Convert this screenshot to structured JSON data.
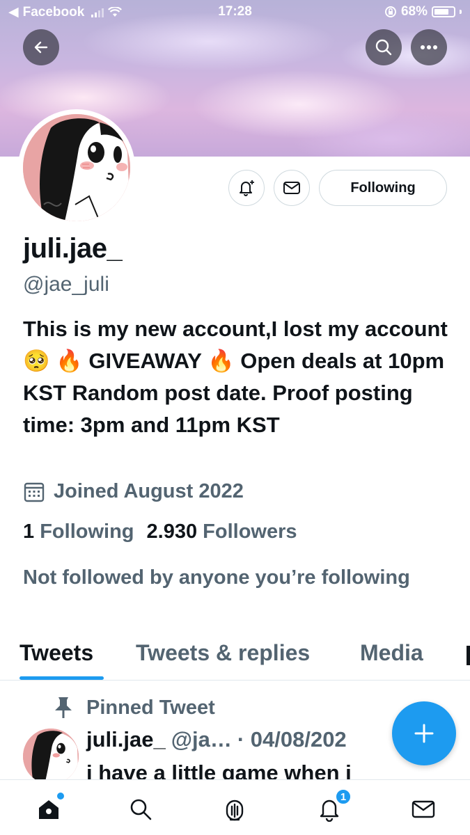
{
  "status_bar": {
    "back_app": "Facebook",
    "time": "17:28",
    "battery": "68%"
  },
  "profile": {
    "display_name": "juli.jae_",
    "handle": "@jae_juli",
    "bio": "This is my new account,I lost my account🥺 🔥 GIVEAWAY 🔥 Open deals at 10pm KST Random post date. Proof posting time: 3pm and 11pm KST",
    "joined": "Joined August 2022",
    "following_count": "1",
    "following_label": "Following",
    "followers_count": "2.930",
    "followers_label": "Followers",
    "not_followed": "Not followed by anyone you’re following",
    "follow_button_label": "Following"
  },
  "tabs": [
    {
      "label": "Tweets",
      "active": true
    },
    {
      "label": "Tweets & replies",
      "active": false
    },
    {
      "label": "Media",
      "active": false
    }
  ],
  "pinned_tweet": {
    "label": "Pinned Tweet",
    "author_name": "juli.jae_",
    "author_handle": "@ja…",
    "date": "· 04/08/202",
    "text": "i have a little game when i"
  },
  "bottom_nav": {
    "notifications_badge": "1"
  },
  "icons": {
    "back": "back-arrow-icon",
    "search": "search-icon",
    "more": "more-icon",
    "notify": "bell-plus-icon",
    "message": "envelope-icon",
    "calendar": "calendar-icon",
    "pin": "pin-icon",
    "compose": "plus-icon",
    "home": "home-icon",
    "explore": "search-icon",
    "spaces": "microphone-icon",
    "notifications": "bell-icon",
    "messages": "envelope-icon"
  },
  "colors": {
    "accent": "#1d9bf0",
    "secondary_text": "#536471",
    "primary_text": "#0f1419"
  }
}
